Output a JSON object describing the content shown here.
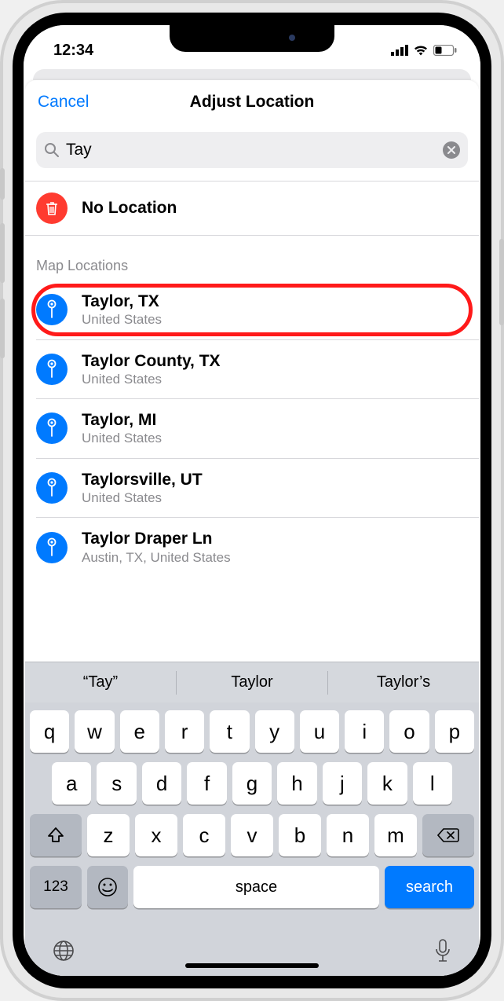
{
  "status": {
    "time": "12:34"
  },
  "nav": {
    "cancel": "Cancel",
    "title": "Adjust Location"
  },
  "search": {
    "query": "Tay"
  },
  "no_location": {
    "label": "No Location"
  },
  "section_header": "Map Locations",
  "results": [
    {
      "title": "Taylor, TX",
      "sub": "United States"
    },
    {
      "title": "Taylor County, TX",
      "sub": "United States"
    },
    {
      "title": "Taylor, MI",
      "sub": "United States"
    },
    {
      "title": "Taylorsville, UT",
      "sub": "United States"
    },
    {
      "title": "Taylor Draper Ln",
      "sub": "Austin, TX, United States"
    }
  ],
  "suggestions": [
    "“Tay”",
    "Taylor",
    "Taylor’s"
  ],
  "keys": {
    "row1": [
      "q",
      "w",
      "e",
      "r",
      "t",
      "y",
      "u",
      "i",
      "o",
      "p"
    ],
    "row2": [
      "a",
      "s",
      "d",
      "f",
      "g",
      "h",
      "j",
      "k",
      "l"
    ],
    "row3": [
      "z",
      "x",
      "c",
      "v",
      "b",
      "n",
      "m"
    ],
    "num": "123",
    "space": "space",
    "search": "search"
  }
}
